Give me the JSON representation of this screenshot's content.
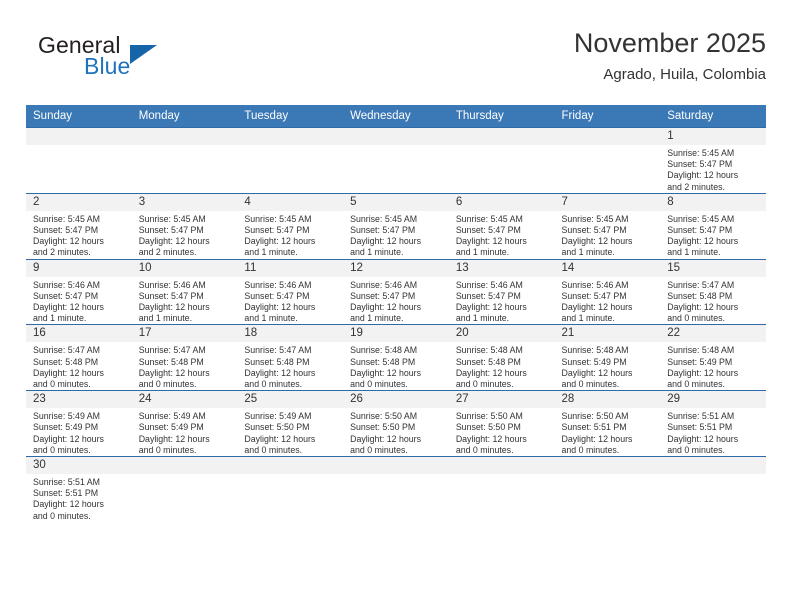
{
  "brand": {
    "name_part1": "General",
    "name_part2": "Blue",
    "accent_color": "#1f72bd",
    "logo_icon": "blue-triangle-icon"
  },
  "header": {
    "title": "November 2025",
    "subtitle": "Agrado, Huila, Colombia"
  },
  "colors": {
    "header_blue": "#3b78b6",
    "row_divider_blue": "#2f6aa8",
    "daynum_band": "#f2f2f2",
    "text": "#333333"
  },
  "weekday_headers": [
    "Sunday",
    "Monday",
    "Tuesday",
    "Wednesday",
    "Thursday",
    "Friday",
    "Saturday"
  ],
  "weeks": [
    [
      {
        "day": "",
        "sunrise": "",
        "sunset": "",
        "daylight1": "",
        "daylight2": ""
      },
      {
        "day": "",
        "sunrise": "",
        "sunset": "",
        "daylight1": "",
        "daylight2": ""
      },
      {
        "day": "",
        "sunrise": "",
        "sunset": "",
        "daylight1": "",
        "daylight2": ""
      },
      {
        "day": "",
        "sunrise": "",
        "sunset": "",
        "daylight1": "",
        "daylight2": ""
      },
      {
        "day": "",
        "sunrise": "",
        "sunset": "",
        "daylight1": "",
        "daylight2": ""
      },
      {
        "day": "",
        "sunrise": "",
        "sunset": "",
        "daylight1": "",
        "daylight2": ""
      },
      {
        "day": "1",
        "sunrise": "Sunrise: 5:45 AM",
        "sunset": "Sunset: 5:47 PM",
        "daylight1": "Daylight: 12 hours",
        "daylight2": "and 2 minutes."
      }
    ],
    [
      {
        "day": "2",
        "sunrise": "Sunrise: 5:45 AM",
        "sunset": "Sunset: 5:47 PM",
        "daylight1": "Daylight: 12 hours",
        "daylight2": "and 2 minutes."
      },
      {
        "day": "3",
        "sunrise": "Sunrise: 5:45 AM",
        "sunset": "Sunset: 5:47 PM",
        "daylight1": "Daylight: 12 hours",
        "daylight2": "and 2 minutes."
      },
      {
        "day": "4",
        "sunrise": "Sunrise: 5:45 AM",
        "sunset": "Sunset: 5:47 PM",
        "daylight1": "Daylight: 12 hours",
        "daylight2": "and 1 minute."
      },
      {
        "day": "5",
        "sunrise": "Sunrise: 5:45 AM",
        "sunset": "Sunset: 5:47 PM",
        "daylight1": "Daylight: 12 hours",
        "daylight2": "and 1 minute."
      },
      {
        "day": "6",
        "sunrise": "Sunrise: 5:45 AM",
        "sunset": "Sunset: 5:47 PM",
        "daylight1": "Daylight: 12 hours",
        "daylight2": "and 1 minute."
      },
      {
        "day": "7",
        "sunrise": "Sunrise: 5:45 AM",
        "sunset": "Sunset: 5:47 PM",
        "daylight1": "Daylight: 12 hours",
        "daylight2": "and 1 minute."
      },
      {
        "day": "8",
        "sunrise": "Sunrise: 5:45 AM",
        "sunset": "Sunset: 5:47 PM",
        "daylight1": "Daylight: 12 hours",
        "daylight2": "and 1 minute."
      }
    ],
    [
      {
        "day": "9",
        "sunrise": "Sunrise: 5:46 AM",
        "sunset": "Sunset: 5:47 PM",
        "daylight1": "Daylight: 12 hours",
        "daylight2": "and 1 minute."
      },
      {
        "day": "10",
        "sunrise": "Sunrise: 5:46 AM",
        "sunset": "Sunset: 5:47 PM",
        "daylight1": "Daylight: 12 hours",
        "daylight2": "and 1 minute."
      },
      {
        "day": "11",
        "sunrise": "Sunrise: 5:46 AM",
        "sunset": "Sunset: 5:47 PM",
        "daylight1": "Daylight: 12 hours",
        "daylight2": "and 1 minute."
      },
      {
        "day": "12",
        "sunrise": "Sunrise: 5:46 AM",
        "sunset": "Sunset: 5:47 PM",
        "daylight1": "Daylight: 12 hours",
        "daylight2": "and 1 minute."
      },
      {
        "day": "13",
        "sunrise": "Sunrise: 5:46 AM",
        "sunset": "Sunset: 5:47 PM",
        "daylight1": "Daylight: 12 hours",
        "daylight2": "and 1 minute."
      },
      {
        "day": "14",
        "sunrise": "Sunrise: 5:46 AM",
        "sunset": "Sunset: 5:47 PM",
        "daylight1": "Daylight: 12 hours",
        "daylight2": "and 1 minute."
      },
      {
        "day": "15",
        "sunrise": "Sunrise: 5:47 AM",
        "sunset": "Sunset: 5:48 PM",
        "daylight1": "Daylight: 12 hours",
        "daylight2": "and 0 minutes."
      }
    ],
    [
      {
        "day": "16",
        "sunrise": "Sunrise: 5:47 AM",
        "sunset": "Sunset: 5:48 PM",
        "daylight1": "Daylight: 12 hours",
        "daylight2": "and 0 minutes."
      },
      {
        "day": "17",
        "sunrise": "Sunrise: 5:47 AM",
        "sunset": "Sunset: 5:48 PM",
        "daylight1": "Daylight: 12 hours",
        "daylight2": "and 0 minutes."
      },
      {
        "day": "18",
        "sunrise": "Sunrise: 5:47 AM",
        "sunset": "Sunset: 5:48 PM",
        "daylight1": "Daylight: 12 hours",
        "daylight2": "and 0 minutes."
      },
      {
        "day": "19",
        "sunrise": "Sunrise: 5:48 AM",
        "sunset": "Sunset: 5:48 PM",
        "daylight1": "Daylight: 12 hours",
        "daylight2": "and 0 minutes."
      },
      {
        "day": "20",
        "sunrise": "Sunrise: 5:48 AM",
        "sunset": "Sunset: 5:48 PM",
        "daylight1": "Daylight: 12 hours",
        "daylight2": "and 0 minutes."
      },
      {
        "day": "21",
        "sunrise": "Sunrise: 5:48 AM",
        "sunset": "Sunset: 5:49 PM",
        "daylight1": "Daylight: 12 hours",
        "daylight2": "and 0 minutes."
      },
      {
        "day": "22",
        "sunrise": "Sunrise: 5:48 AM",
        "sunset": "Sunset: 5:49 PM",
        "daylight1": "Daylight: 12 hours",
        "daylight2": "and 0 minutes."
      }
    ],
    [
      {
        "day": "23",
        "sunrise": "Sunrise: 5:49 AM",
        "sunset": "Sunset: 5:49 PM",
        "daylight1": "Daylight: 12 hours",
        "daylight2": "and 0 minutes."
      },
      {
        "day": "24",
        "sunrise": "Sunrise: 5:49 AM",
        "sunset": "Sunset: 5:49 PM",
        "daylight1": "Daylight: 12 hours",
        "daylight2": "and 0 minutes."
      },
      {
        "day": "25",
        "sunrise": "Sunrise: 5:49 AM",
        "sunset": "Sunset: 5:50 PM",
        "daylight1": "Daylight: 12 hours",
        "daylight2": "and 0 minutes."
      },
      {
        "day": "26",
        "sunrise": "Sunrise: 5:50 AM",
        "sunset": "Sunset: 5:50 PM",
        "daylight1": "Daylight: 12 hours",
        "daylight2": "and 0 minutes."
      },
      {
        "day": "27",
        "sunrise": "Sunrise: 5:50 AM",
        "sunset": "Sunset: 5:50 PM",
        "daylight1": "Daylight: 12 hours",
        "daylight2": "and 0 minutes."
      },
      {
        "day": "28",
        "sunrise": "Sunrise: 5:50 AM",
        "sunset": "Sunset: 5:51 PM",
        "daylight1": "Daylight: 12 hours",
        "daylight2": "and 0 minutes."
      },
      {
        "day": "29",
        "sunrise": "Sunrise: 5:51 AM",
        "sunset": "Sunset: 5:51 PM",
        "daylight1": "Daylight: 12 hours",
        "daylight2": "and 0 minutes."
      }
    ],
    [
      {
        "day": "30",
        "sunrise": "Sunrise: 5:51 AM",
        "sunset": "Sunset: 5:51 PM",
        "daylight1": "Daylight: 12 hours",
        "daylight2": "and 0 minutes."
      },
      {
        "day": "",
        "sunrise": "",
        "sunset": "",
        "daylight1": "",
        "daylight2": ""
      },
      {
        "day": "",
        "sunrise": "",
        "sunset": "",
        "daylight1": "",
        "daylight2": ""
      },
      {
        "day": "",
        "sunrise": "",
        "sunset": "",
        "daylight1": "",
        "daylight2": ""
      },
      {
        "day": "",
        "sunrise": "",
        "sunset": "",
        "daylight1": "",
        "daylight2": ""
      },
      {
        "day": "",
        "sunrise": "",
        "sunset": "",
        "daylight1": "",
        "daylight2": ""
      },
      {
        "day": "",
        "sunrise": "",
        "sunset": "",
        "daylight1": "",
        "daylight2": ""
      }
    ]
  ]
}
